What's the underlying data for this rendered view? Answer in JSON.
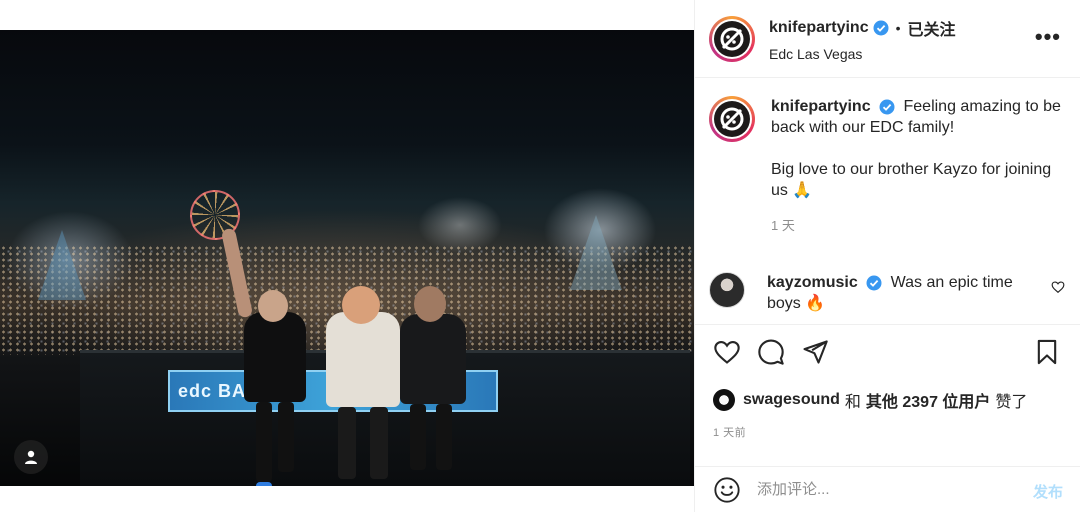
{
  "header": {
    "username": "knifepartyinc",
    "dot": "•",
    "follow_status": "已关注",
    "location": "Edc Las Vegas",
    "more": "•••"
  },
  "photo": {
    "banner_text": "edc BASS"
  },
  "caption": {
    "username": "knifepartyinc",
    "line1": "Feeling amazing to be back with our EDC family!",
    "line2": "Big love to our brother Kayzo for joining us 🙏",
    "time": "1 天"
  },
  "comments": [
    {
      "username": "kayzomusic",
      "text": "Was an epic time boys 🔥"
    }
  ],
  "likes": {
    "user": "swagesound",
    "connector": "和",
    "others": "其他 2397 位用户",
    "suffix": "赞了"
  },
  "post_time": "1 天前",
  "comment_box": {
    "placeholder": "添加评论...",
    "post_label": "发布"
  },
  "colors": {
    "verified": "#3897f0",
    "post_disabled": "#b2dffc",
    "muted": "#8e8e8e"
  }
}
